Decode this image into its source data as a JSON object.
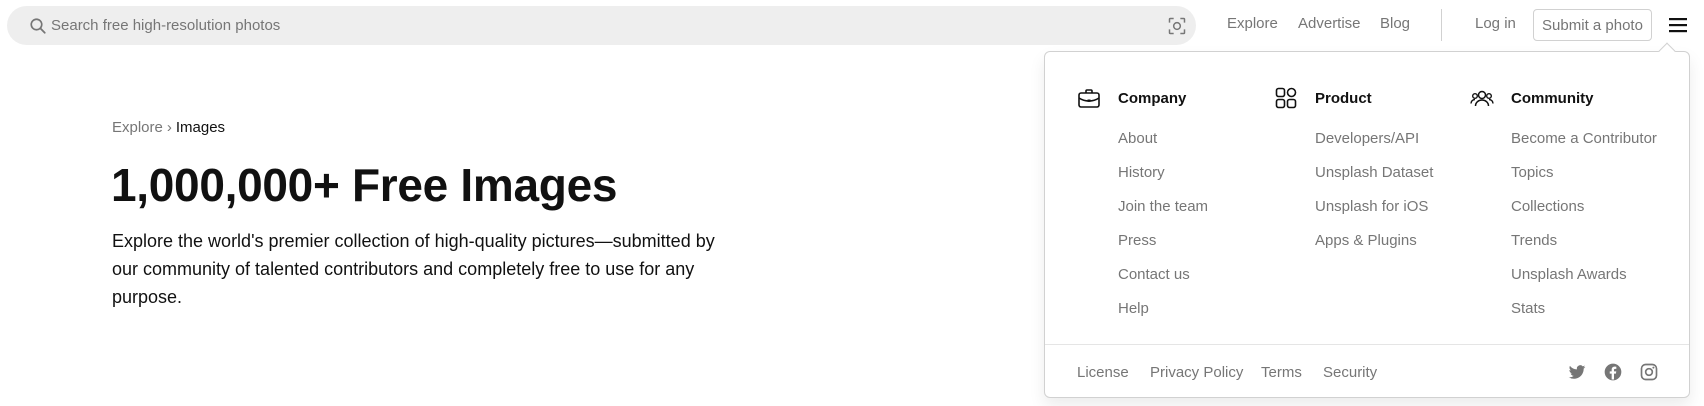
{
  "search": {
    "placeholder": "Search free high-resolution photos",
    "value": ""
  },
  "nav": {
    "explore": "Explore",
    "advertise": "Advertise",
    "blog": "Blog",
    "login": "Log in",
    "submit": "Submit a photo"
  },
  "hero": {
    "breadcrumb_parent": "Explore",
    "breadcrumb_sep": "›",
    "breadcrumb_current": "Images",
    "title": "1,000,000+ Free Images",
    "description": "Explore the world's premier collection of high-quality pictures—submitted by our community of talented contributors and completely free to use for any purpose."
  },
  "menu": {
    "columns": [
      {
        "title": "Company",
        "icon": "briefcase-icon",
        "items": [
          "About",
          "History",
          "Join the team",
          "Press",
          "Contact us",
          "Help"
        ]
      },
      {
        "title": "Product",
        "icon": "grid-shapes-icon",
        "items": [
          "Developers/API",
          "Unsplash Dataset",
          "Unsplash for iOS",
          "Apps & Plugins"
        ]
      },
      {
        "title": "Community",
        "icon": "people-icon",
        "items": [
          "Become a Contributor",
          "Topics",
          "Collections",
          "Trends",
          "Unsplash Awards",
          "Stats"
        ]
      }
    ],
    "footer_links": [
      "License",
      "Privacy Policy",
      "Terms",
      "Security"
    ],
    "social": [
      "twitter-icon",
      "facebook-icon",
      "instagram-icon"
    ]
  },
  "colors": {
    "text_primary": "#111111",
    "text_secondary": "#767676",
    "search_bg": "#eeeeee",
    "border": "#d1d1d1"
  }
}
